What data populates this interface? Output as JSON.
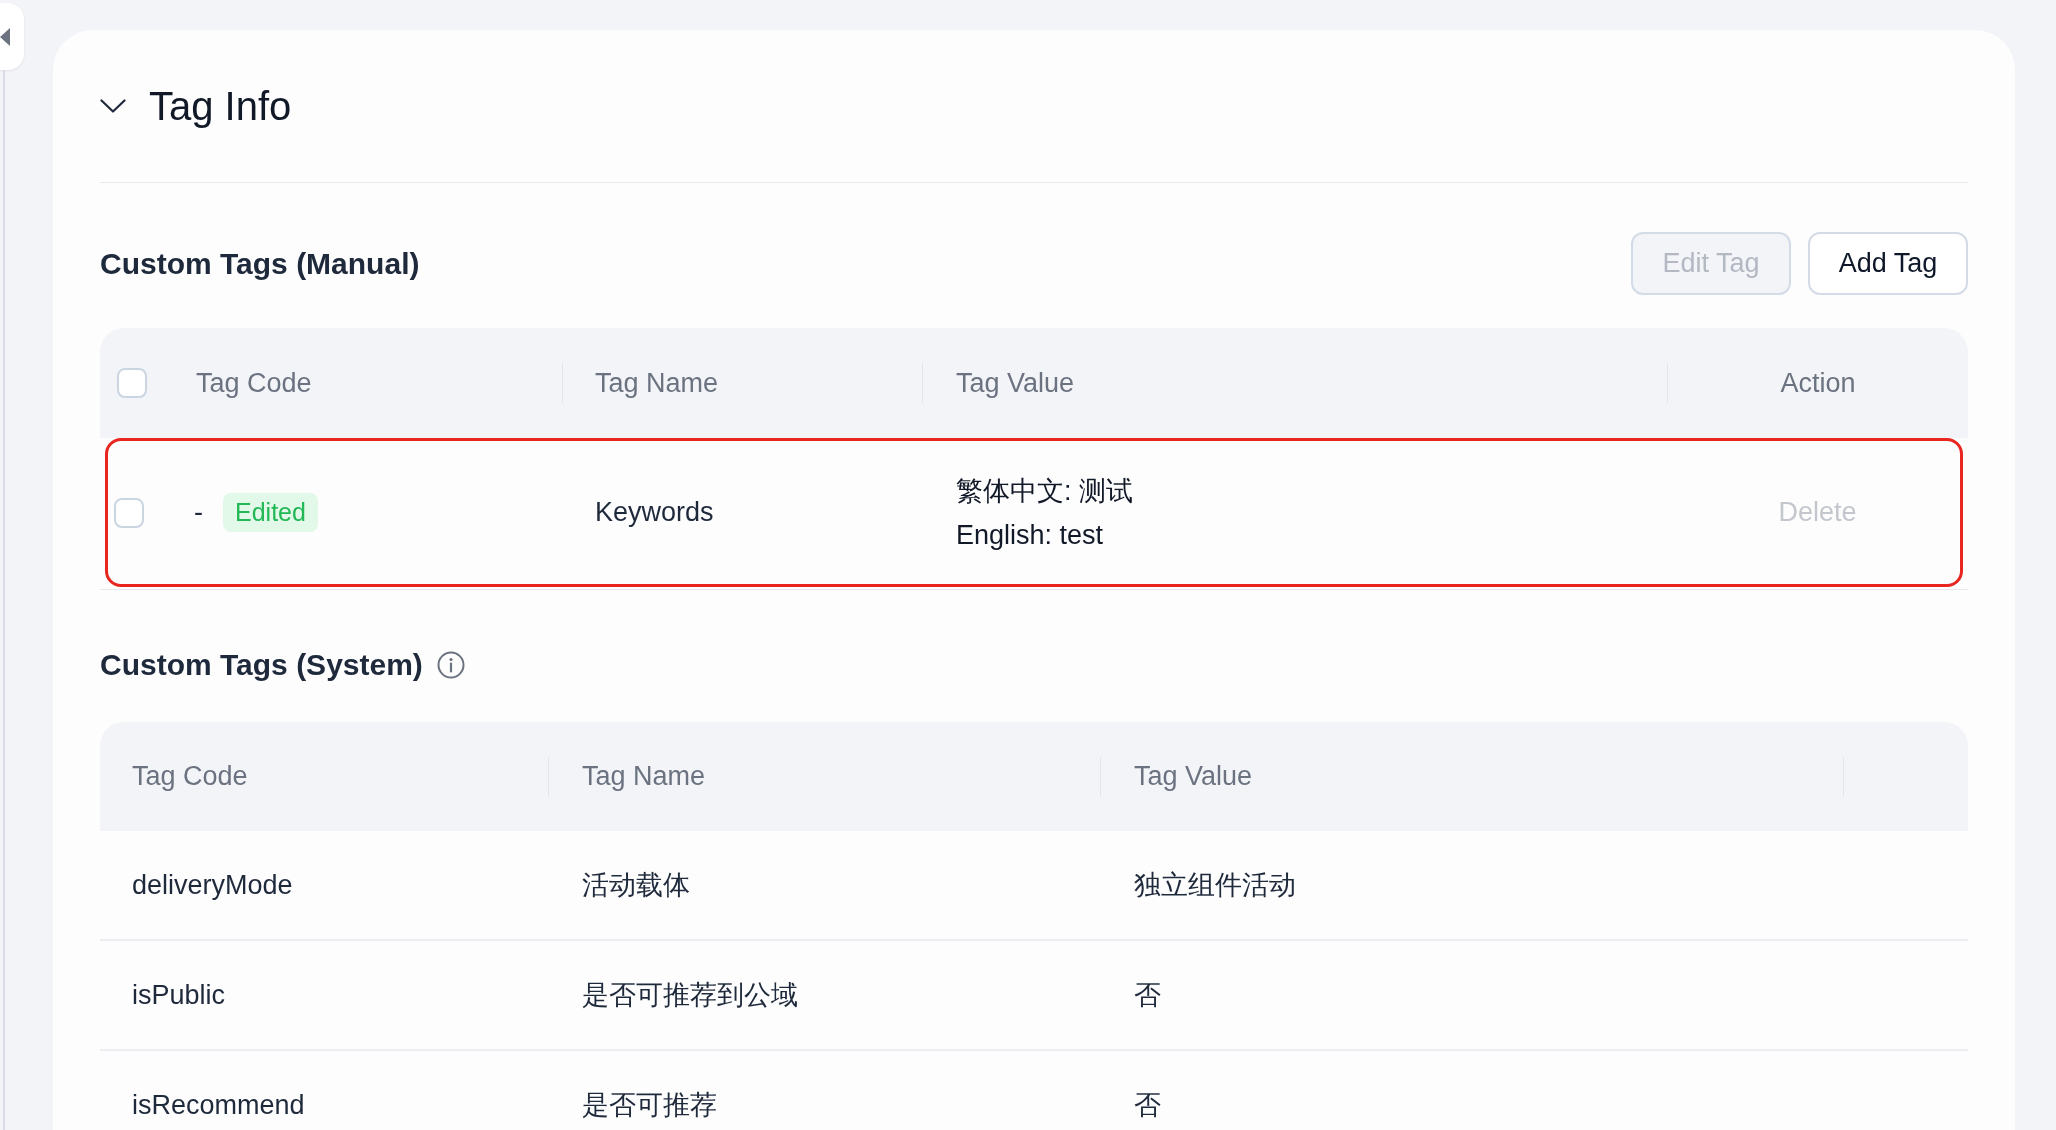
{
  "section": {
    "title": "Tag Info",
    "expanded": true
  },
  "manual_tags": {
    "title": "Custom Tags (Manual)",
    "buttons": [
      {
        "label": "Edit Tag",
        "disabled": true
      },
      {
        "label": "Add Tag",
        "disabled": false
      }
    ],
    "header": {
      "checked": false,
      "columns": [
        "Tag Code",
        "Tag Name",
        "Tag Value",
        "Action"
      ]
    },
    "rows": [
      {
        "checked": false,
        "highlighted": true,
        "tag_code": "-",
        "badge": "Edited",
        "tag_name": "Keywords",
        "tag_value": [
          "繁体中文: 测试",
          "English: test"
        ],
        "action": {
          "label": "Delete",
          "disabled": true
        }
      }
    ]
  },
  "system_tags": {
    "title": "Custom Tags (System)",
    "columns": [
      "Tag Code",
      "Tag Name",
      "Tag Value"
    ],
    "rows": [
      {
        "tag_code": "deliveryMode",
        "tag_name": "活动载体",
        "tag_value": "独立组件活动"
      },
      {
        "tag_code": "isPublic",
        "tag_name": "是否可推荐到公域",
        "tag_value": "否"
      },
      {
        "tag_code": "isRecommend",
        "tag_name": "是否可推荐",
        "tag_value": "否"
      }
    ]
  }
}
